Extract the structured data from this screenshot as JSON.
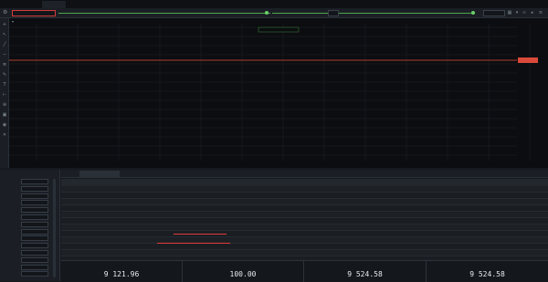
{
  "tabs": [
    {
      "label": "",
      "active": false
    },
    {
      "label": "",
      "active": true
    },
    {
      "label": "",
      "active": false
    }
  ],
  "toolbar": {
    "symbol_value": "",
    "date_from": "",
    "date_to": ""
  },
  "chart_data": {
    "type": "candlestick",
    "price_line_color": "#e0523a",
    "up_color": "#6fbf3f",
    "down_color": "#f07a4a",
    "candles": []
  },
  "chart": {
    "symbol": "",
    "badge": "",
    "right_label": "",
    "price_label": "",
    "x_ticks": [
      "",
      "",
      "",
      "",
      "",
      "",
      "",
      "",
      "",
      "",
      "",
      "",
      ""
    ],
    "y_ticks": [
      "",
      "",
      "",
      "",
      "",
      "",
      "",
      "",
      "",
      "",
      "",
      "",
      "",
      ""
    ]
  },
  "left_panel": {
    "title": "",
    "rows": [
      {
        "label": "",
        "value": ""
      },
      {
        "label": "",
        "value": ""
      },
      {
        "label": "",
        "value": ""
      },
      {
        "label": "",
        "value": ""
      },
      {
        "label": "",
        "value": ""
      },
      {
        "label": "",
        "value": ""
      },
      {
        "label": "",
        "value": ""
      },
      {
        "label": "",
        "value": ""
      },
      {
        "label": "",
        "value": ""
      },
      {
        "label": "",
        "value": ""
      },
      {
        "label": "",
        "value": ""
      },
      {
        "label": "",
        "value": ""
      },
      {
        "label": "",
        "value": ""
      },
      {
        "label": "",
        "value": ""
      }
    ]
  },
  "bottom_tabs": [
    {
      "label": "",
      "active": false
    },
    {
      "label": "",
      "active": true
    },
    {
      "label": "",
      "active": false
    },
    {
      "label": "",
      "active": false
    },
    {
      "label": "",
      "active": false
    },
    {
      "label": "",
      "active": false
    },
    {
      "label": "",
      "active": false
    },
    {
      "label": "",
      "active": false
    }
  ],
  "results": {
    "columns": [
      "",
      "",
      "",
      ""
    ],
    "rows": [
      {
        "label": "",
        "all": "",
        "long": "",
        "short": ""
      },
      {
        "label": "",
        "all": "",
        "long": "",
        "short": ""
      },
      {
        "label": "",
        "all": "",
        "long": "",
        "short": ""
      },
      {
        "label": "",
        "all": "",
        "long": "",
        "short": ""
      },
      {
        "label": "",
        "all": "",
        "long": "",
        "short": ""
      },
      {
        "label": "",
        "all": "",
        "long": "",
        "short": ""
      },
      {
        "label": "",
        "all": "",
        "long": "",
        "short": ""
      },
      {
        "label": "",
        "all": "",
        "long": "",
        "short": ""
      },
      {
        "label": "",
        "all": "",
        "long": "",
        "short": ""
      },
      {
        "label": "",
        "all": "",
        "long": "",
        "short": ""
      },
      {
        "label": "",
        "all": "",
        "long": "",
        "short": ""
      },
      {
        "label": "",
        "all": "",
        "long": "",
        "short": ""
      }
    ],
    "footer": [
      {
        "label": "",
        "value": "9 121.96"
      },
      {
        "label": "",
        "value": "100.00"
      },
      {
        "label": "",
        "value": "9 524.58"
      },
      {
        "label": "",
        "value": "9 524.58"
      }
    ]
  }
}
